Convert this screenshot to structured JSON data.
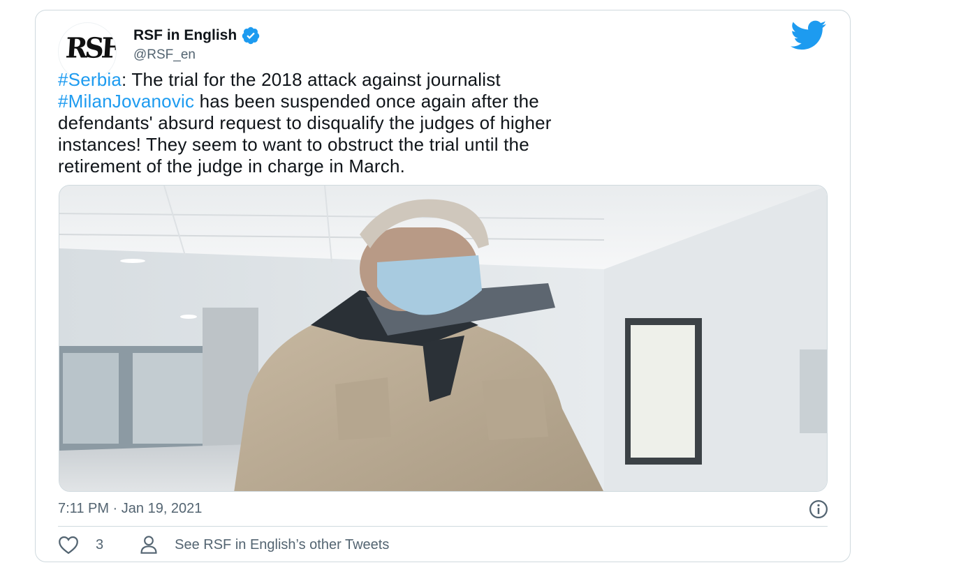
{
  "tweet": {
    "author_name": "RSF in English",
    "author_handle": "@RSF_en",
    "avatar_logo_text": "RSF",
    "text_segments": [
      {
        "text": "#Serbia",
        "type": "hashtag"
      },
      {
        "text": ": The trial for the 2018 attack against journalist\n",
        "type": "text"
      },
      {
        "text": "#MilanJovanovic",
        "type": "hashtag"
      },
      {
        "text": " has been suspended once again after the\ndefendants' absurd request to disqualify the judges of higher\ninstances! They seem to want to obstruct the trial until the\nretirement of the judge in charge in March.",
        "type": "text"
      }
    ],
    "timestamp": "7:11 PM · Jan 19, 2021",
    "like_count": "3",
    "other_tweets_label": "See RSF in English’s other Tweets"
  },
  "icons": {
    "verified": "verified-badge-icon",
    "brand": "twitter-bird-icon",
    "info": "info-icon",
    "like": "heart-icon",
    "profile": "person-icon"
  },
  "colors": {
    "accent": "#1d9bf0",
    "text": "#0f1419",
    "secondary": "#536471",
    "border": "#cfd9de"
  }
}
